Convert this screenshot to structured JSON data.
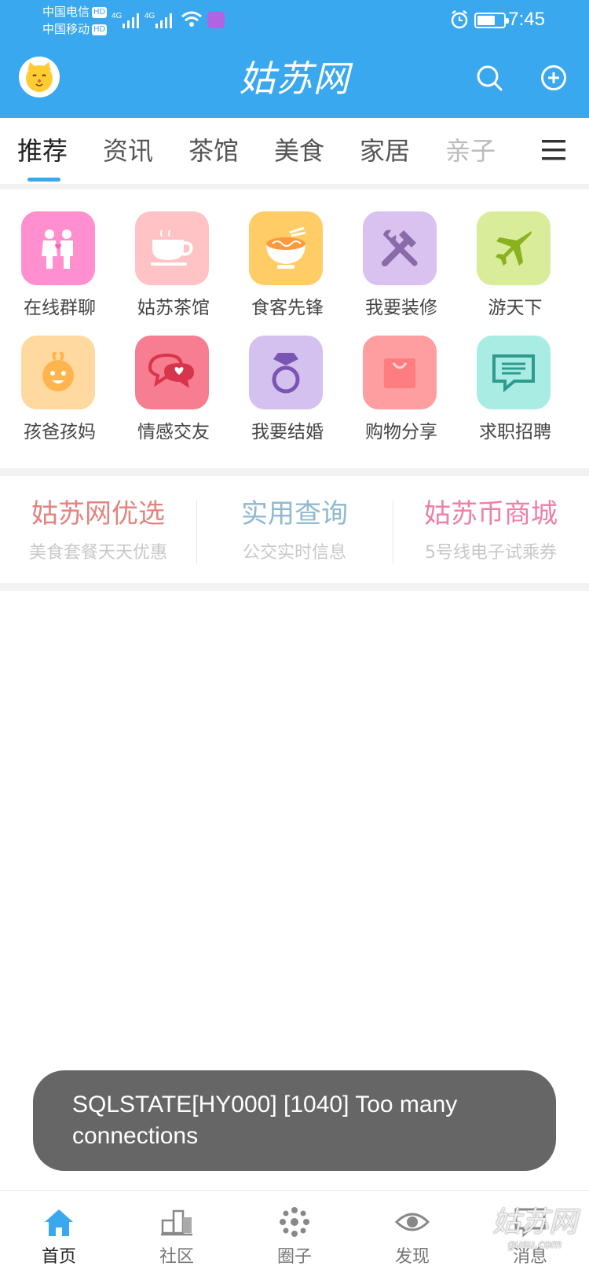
{
  "status_bar": {
    "carrier1": "中国电信",
    "carrier2": "中国移动",
    "hd_badge": "HD",
    "network": "4G",
    "time": "7:45"
  },
  "header": {
    "logo_text": "姑苏网",
    "avatar_icon": "cat-avatar-icon",
    "search_icon": "search-icon",
    "add_icon": "add-circle-icon",
    "bg_color": "#39a8ee"
  },
  "tabs": [
    {
      "label": "推荐",
      "active": true
    },
    {
      "label": "资讯"
    },
    {
      "label": "茶馆"
    },
    {
      "label": "美食"
    },
    {
      "label": "家居"
    },
    {
      "label": "亲子"
    }
  ],
  "grid": [
    {
      "label": "在线群聊",
      "icon": "couple-icon",
      "color": "#ff8fcf"
    },
    {
      "label": "姑苏茶馆",
      "icon": "teacup-icon",
      "color": "#ffc3c6"
    },
    {
      "label": "食客先锋",
      "icon": "noodle-bowl-icon",
      "color": "#ffcc66"
    },
    {
      "label": "我要装修",
      "icon": "tools-icon",
      "color": "#d9c2ef"
    },
    {
      "label": "游天下",
      "icon": "airplane-icon",
      "color": "#d8ec9a"
    },
    {
      "label": "孩爸孩妈",
      "icon": "baby-icon",
      "color": "#ffd9a0"
    },
    {
      "label": "情感交友",
      "icon": "chat-heart-icon",
      "color": "#f77e91"
    },
    {
      "label": "我要结婚",
      "icon": "ring-icon",
      "color": "#d5c1ef"
    },
    {
      "label": "购物分享",
      "icon": "shopping-bag-icon",
      "color": "#ff9ea0"
    },
    {
      "label": "求职招聘",
      "icon": "message-icon",
      "color": "#a8ece4"
    }
  ],
  "promo": [
    {
      "title": "姑苏网优选",
      "subtitle": "美食套餐天天优惠",
      "color": "#e2847f"
    },
    {
      "title": "实用查询",
      "subtitle": "公交实时信息",
      "color": "#8fb9cf"
    },
    {
      "title": "姑苏币商城",
      "subtitle": "5号线电子试乘券",
      "color": "#ee7fa8"
    }
  ],
  "toast": {
    "message": "SQLSTATE[HY000] [1040] Too many connections"
  },
  "bottom_nav": [
    {
      "label": "首页",
      "icon": "home-icon",
      "active": true
    },
    {
      "label": "社区",
      "icon": "community-icon"
    },
    {
      "label": "圈子",
      "icon": "circle-dots-icon"
    },
    {
      "label": "发现",
      "icon": "eye-icon"
    },
    {
      "label": "消息",
      "icon": "message-bubble-icon"
    }
  ],
  "watermark": {
    "text": "姑苏网",
    "url_text": "gusu.com"
  }
}
